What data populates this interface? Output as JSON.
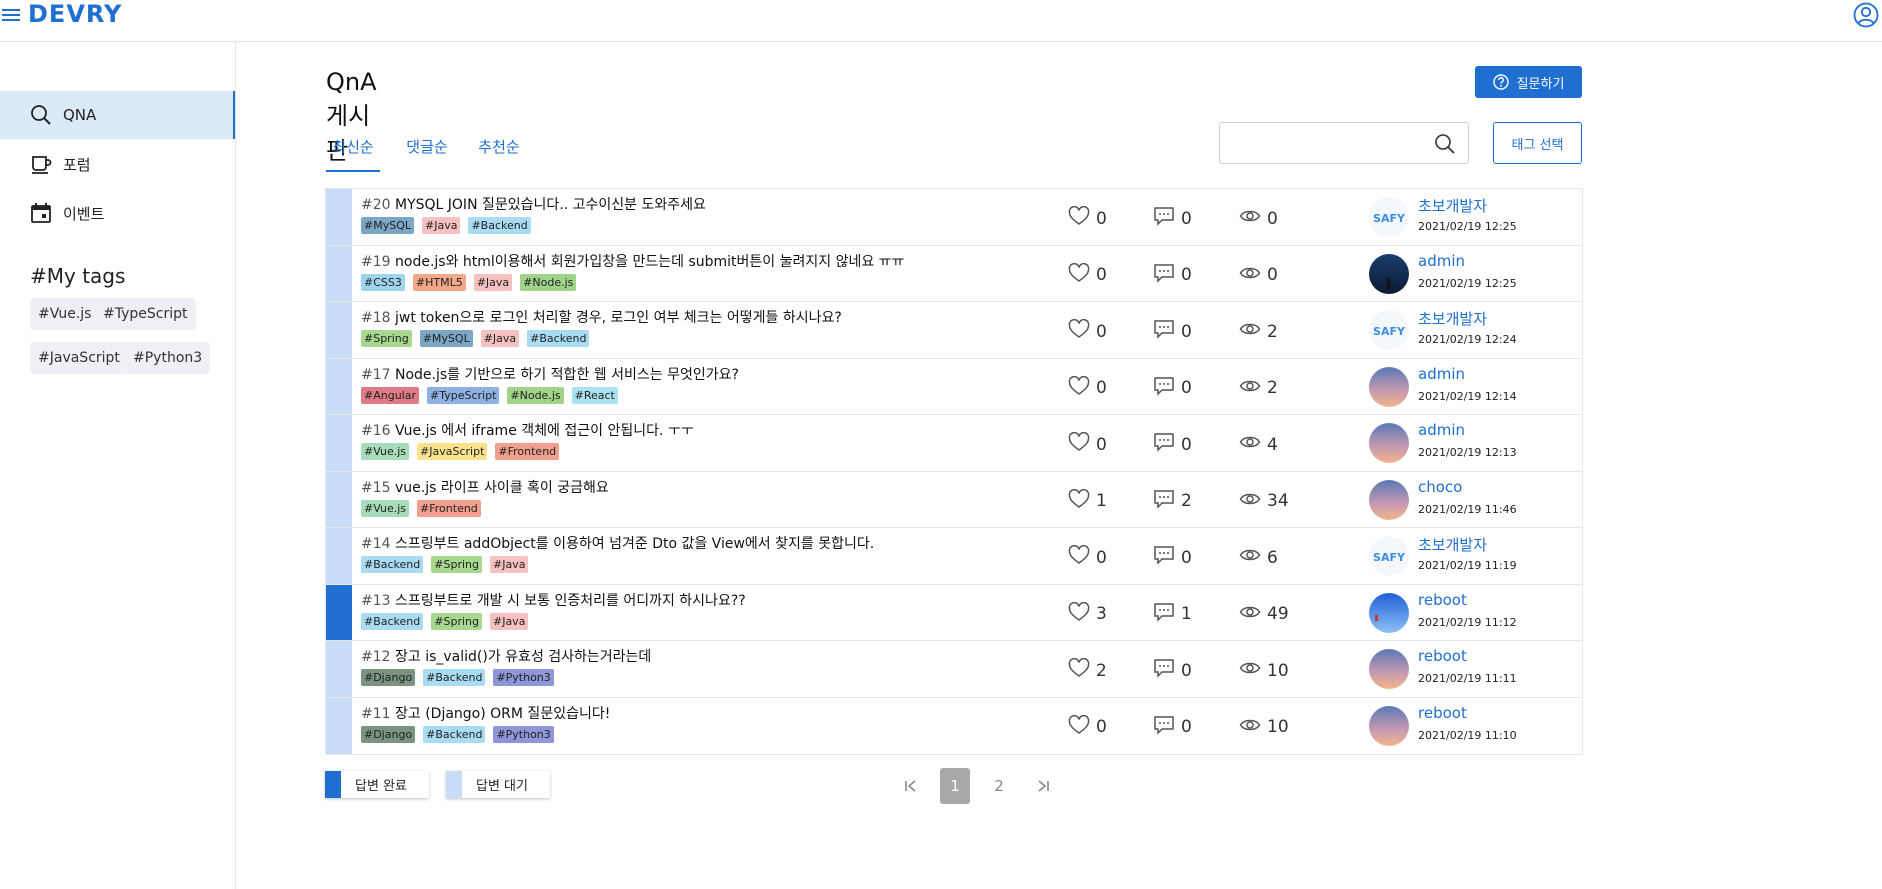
{
  "app": {
    "logo": "DEVRY"
  },
  "sidebar": {
    "items": [
      {
        "label": "QNA",
        "icon": "search-icon",
        "active": true
      },
      {
        "label": "포럼",
        "icon": "cup-icon",
        "active": false
      },
      {
        "label": "이벤트",
        "icon": "calendar-icon",
        "active": false
      }
    ],
    "my_tags_title": "#My tags",
    "my_tags": [
      "#Vue.js",
      "#TypeScript",
      "#JavaScript",
      "#Python3"
    ]
  },
  "main": {
    "title": "QnA 게시판",
    "ask_button": "질문하기",
    "tabs": [
      "최신순",
      "댓글순",
      "추천순"
    ],
    "search": {
      "placeholder": "",
      "value": ""
    },
    "tag_select": "태그 선택"
  },
  "tag_colors": {
    "#MySQL": "#7ca6c6",
    "#Java": "#f7c1c1",
    "#Backend": "#a9dcf3",
    "#CSS3": "#9fd4ee",
    "#HTML5": "#f4a88a",
    "#Node.js": "#9fd48a",
    "#Spring": "#a7d88f",
    "#Angular": "#e07b86",
    "#TypeScript": "#8fb0e3",
    "#React": "#a9e3f3",
    "#Vue.js": "#a6dcb9",
    "#JavaScript": "#fbe38e",
    "#Frontend": "#f2a08e",
    "#Django": "#7a9481",
    "#Python3": "#8e95d9"
  },
  "posts": [
    {
      "num": "#20",
      "title": "MYSQL JOIN 질문있습니다.. 고수이신분 도와주세요",
      "tags": [
        "#MySQL",
        "#Java",
        "#Backend"
      ],
      "likes": "0",
      "comments": "0",
      "views": "0",
      "author": "초보개발자",
      "date": "2021/02/19 12:25",
      "avatar": "ssafy",
      "answered": false
    },
    {
      "num": "#19",
      "title": "node.js와 html이용해서 회원가입창을 만드는데 submit버튼이 눌려지지 않네요 ㅠㅠ",
      "tags": [
        "#CSS3",
        "#HTML5",
        "#Java",
        "#Node.js"
      ],
      "likes": "0",
      "comments": "0",
      "views": "0",
      "author": "admin",
      "date": "2021/02/19 12:25",
      "avatar": "night",
      "answered": false
    },
    {
      "num": "#18",
      "title": "jwt token으로 로그인 처리할 경우, 로그인 여부 체크는 어떻게들 하시나요?",
      "tags": [
        "#Spring",
        "#MySQL",
        "#Java",
        "#Backend"
      ],
      "likes": "0",
      "comments": "0",
      "views": "2",
      "author": "초보개발자",
      "date": "2021/02/19 12:24",
      "avatar": "ssafy",
      "answered": false
    },
    {
      "num": "#17",
      "title": "Node.js를 기반으로 하기 적합한 웹 서비스는 무엇인가요?",
      "tags": [
        "#Angular",
        "#TypeScript",
        "#Node.js",
        "#React"
      ],
      "likes": "0",
      "comments": "0",
      "views": "2",
      "author": "admin",
      "date": "2021/02/19 12:14",
      "avatar": "sunset",
      "answered": false
    },
    {
      "num": "#16",
      "title": "Vue.js 에서 iframe 객체에 접근이 안됩니다. ㅜㅜ",
      "tags": [
        "#Vue.js",
        "#JavaScript",
        "#Frontend"
      ],
      "likes": "0",
      "comments": "0",
      "views": "4",
      "author": "admin",
      "date": "2021/02/19 12:13",
      "avatar": "sunset",
      "answered": false
    },
    {
      "num": "#15",
      "title": "vue.js 라이프 사이클 혹이 궁금해요",
      "tags": [
        "#Vue.js",
        "#Frontend"
      ],
      "likes": "1",
      "comments": "2",
      "views": "34",
      "author": "choco",
      "date": "2021/02/19 11:46",
      "avatar": "sunset",
      "answered": false
    },
    {
      "num": "#14",
      "title": "스프링부트 addObject를 이용하여 넘겨준 Dto 값을 View에서 찾지를 못합니다.",
      "tags": [
        "#Backend",
        "#Spring",
        "#Java"
      ],
      "likes": "0",
      "comments": "0",
      "views": "6",
      "author": "초보개발자",
      "date": "2021/02/19 11:19",
      "avatar": "ssafy",
      "answered": false
    },
    {
      "num": "#13",
      "title": "스프링부트로 개발 시 보통 인증처리를 어디까지 하시나요??",
      "tags": [
        "#Backend",
        "#Spring",
        "#Java"
      ],
      "likes": "3",
      "comments": "1",
      "views": "49",
      "author": "reboot",
      "date": "2021/02/19 11:12",
      "avatar": "sky",
      "answered": true
    },
    {
      "num": "#12",
      "title": "장고 is_valid()가 유효성 검사하는거라는데",
      "tags": [
        "#Django",
        "#Backend",
        "#Python3"
      ],
      "likes": "2",
      "comments": "0",
      "views": "10",
      "author": "reboot",
      "date": "2021/02/19 11:11",
      "avatar": "sunset",
      "answered": false
    },
    {
      "num": "#11",
      "title": "장고 (Django) ORM 질문있습니다!",
      "tags": [
        "#Django",
        "#Backend",
        "#Python3"
      ],
      "likes": "0",
      "comments": "0",
      "views": "10",
      "author": "reboot",
      "date": "2021/02/19 11:10",
      "avatar": "sunset",
      "answered": false
    }
  ],
  "legend": {
    "answered": "답변 완료",
    "waiting": "답변 대기",
    "answered_color": "#1e6fd1",
    "waiting_color": "#c9dcf7"
  },
  "pagination": {
    "pages": [
      "1",
      "2"
    ],
    "current": "1"
  }
}
